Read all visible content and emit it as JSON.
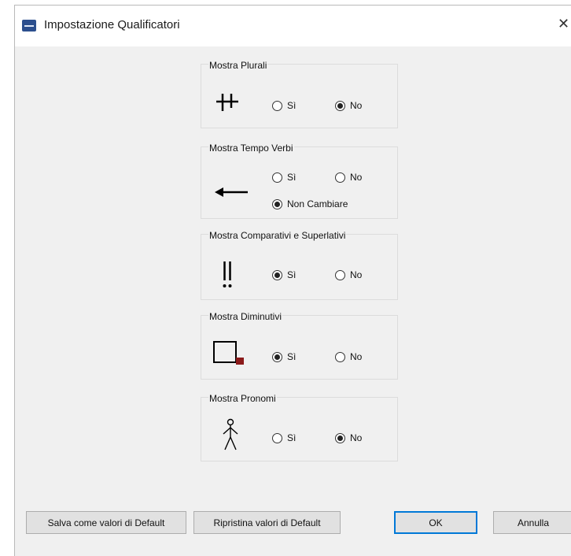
{
  "window": {
    "title": "Impostazione Qualificatori",
    "close": "✕"
  },
  "groups": {
    "plurali": {
      "title": "Mostra Plurali",
      "options": [
        "Sì",
        "No"
      ],
      "selected": "No",
      "icon": "plural-cross-icon"
    },
    "tempo": {
      "title": "Mostra Tempo Verbi",
      "options": [
        "Sì",
        "No",
        "Non Cambiare"
      ],
      "selected": "Non Cambiare",
      "icon": "left-arrow-icon"
    },
    "comparativi": {
      "title": "Mostra Comparativi e Superlativi",
      "options": [
        "Sì",
        "No"
      ],
      "selected": "Sì",
      "icon": "double-exclamation-icon"
    },
    "diminutivi": {
      "title": "Mostra Diminutivi",
      "options": [
        "Sì",
        "No"
      ],
      "selected": "Sì",
      "icon": "small-square-icon"
    },
    "pronomi": {
      "title": "Mostra Pronomi",
      "options": [
        "Sì",
        "No"
      ],
      "selected": "No",
      "icon": "person-icon"
    }
  },
  "buttons": {
    "save_default": "Salva come valori di Default",
    "restore_default": "Ripristina valori di Default",
    "ok": "OK",
    "cancel": "Annulla"
  },
  "colors": {
    "diminutive_marker": "#8b1a1a",
    "default_button_border": "#0078d7"
  }
}
